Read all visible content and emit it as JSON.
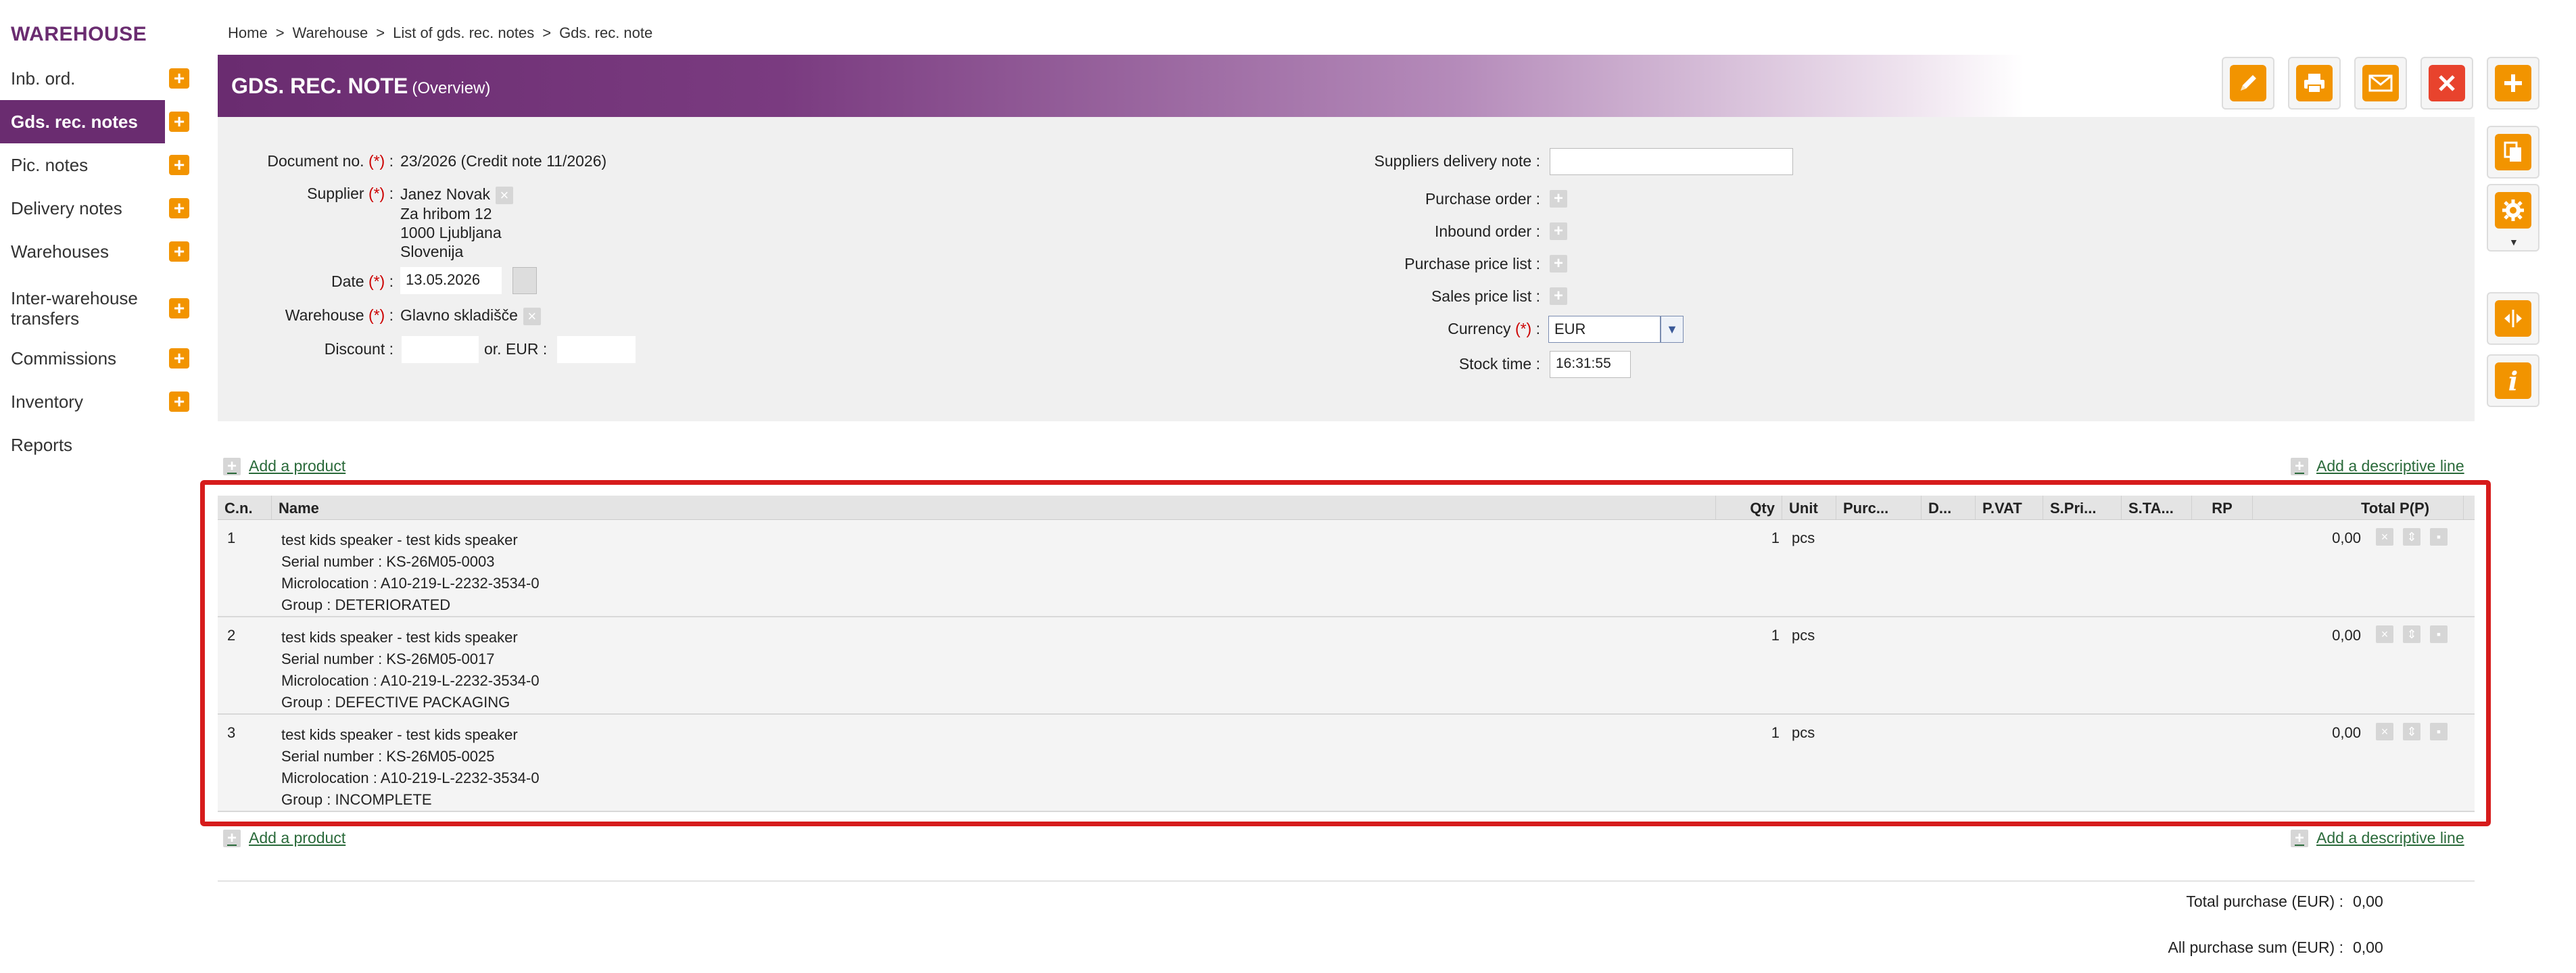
{
  "sidebar": {
    "title": "WAREHOUSE",
    "items": [
      {
        "label": "Inb. ord.",
        "has_plus": true
      },
      {
        "label": "Gds. rec. notes",
        "has_plus": true,
        "active": true
      },
      {
        "label": "Pic. notes",
        "has_plus": true
      },
      {
        "label": "Delivery notes",
        "has_plus": true
      },
      {
        "label": "Warehouses",
        "has_plus": true
      },
      {
        "label": "Inter-warehouse transfers",
        "has_plus": true
      },
      {
        "label": "Commissions",
        "has_plus": true
      },
      {
        "label": "Inventory",
        "has_plus": true
      },
      {
        "label": "Reports",
        "has_plus": false
      }
    ]
  },
  "breadcrumb": [
    "Home",
    "Warehouse",
    "List of gds. rec. notes",
    "Gds. rec. note"
  ],
  "breadcrumb_sep": ">",
  "header": {
    "title": "GDS. REC. NOTE",
    "subtitle": "(Overview)"
  },
  "colors": {
    "brand": "#6a2c70",
    "accent": "#f29400",
    "danger": "#e8432d",
    "highlight": "#d61c1c"
  },
  "toolbar_icons": [
    "edit-icon",
    "print-icon",
    "email-icon",
    "delete-icon",
    "add-icon",
    "copy-icon",
    "settings-icon",
    "chevron-down-icon",
    "split-icon",
    "info-icon"
  ],
  "form": {
    "required_mark": "(*)",
    "document_no_label": "Document no.",
    "document_no": "23/2026 (Credit note 11/2026)",
    "supplier_label": "Supplier",
    "supplier_lines": [
      "Janez Novak",
      "Za hribom 12",
      "1000 Ljubljana",
      "Slovenija"
    ],
    "date_label": "Date",
    "date": "13.05.2026",
    "warehouse_label": "Warehouse",
    "warehouse": "Glavno skladišče",
    "discount_label": "Discount :",
    "discount_or": "or. EUR :",
    "discount_value": "",
    "discount_eur": "",
    "suppliers_delivery_note_label": "Suppliers delivery note :",
    "suppliers_delivery_note": "",
    "purchase_order_label": "Purchase order :",
    "inbound_order_label": "Inbound order :",
    "purchase_price_list_label": "Purchase price list :",
    "sales_price_list_label": "Sales price list :",
    "currency_label": "Currency",
    "currency": "EUR",
    "stock_time_label": "Stock time :",
    "stock_time": "16:31:55"
  },
  "links": {
    "add_product": "Add a product",
    "add_descriptive_line": "Add a descriptive line"
  },
  "table": {
    "columns": [
      "C.n.",
      "Name",
      "Qty",
      "Unit",
      "Purc...",
      "D...",
      "P.VAT",
      "S.Pri...",
      "S.TA...",
      "RP",
      "Total P(P)"
    ],
    "rows": [
      {
        "cn": "1",
        "name": "test kids speaker - test kids speaker",
        "serial": "Serial number : KS-26M05-0003",
        "microlocation": "Microlocation : A10-219-L-2232-3534-0",
        "group": "Group : DETERIORATED",
        "qty": "1",
        "unit": "pcs",
        "total": "0,00"
      },
      {
        "cn": "2",
        "name": "test kids speaker - test kids speaker",
        "serial": "Serial number : KS-26M05-0017",
        "microlocation": "Microlocation : A10-219-L-2232-3534-0",
        "group": "Group : DEFECTIVE PACKAGING",
        "qty": "1",
        "unit": "pcs",
        "total": "0,00"
      },
      {
        "cn": "3",
        "name": "test kids speaker - test kids speaker",
        "serial": "Serial number : KS-26M05-0025",
        "microlocation": "Microlocation : A10-219-L-2232-3534-0",
        "group": "Group : INCOMPLETE",
        "qty": "1",
        "unit": "pcs",
        "total": "0,00"
      }
    ]
  },
  "totals": {
    "total_purchase_label": "Total purchase (EUR) :",
    "total_purchase": "0,00",
    "all_purchase_sum_label": "All purchase sum (EUR) :",
    "all_purchase_sum": "0,00"
  }
}
